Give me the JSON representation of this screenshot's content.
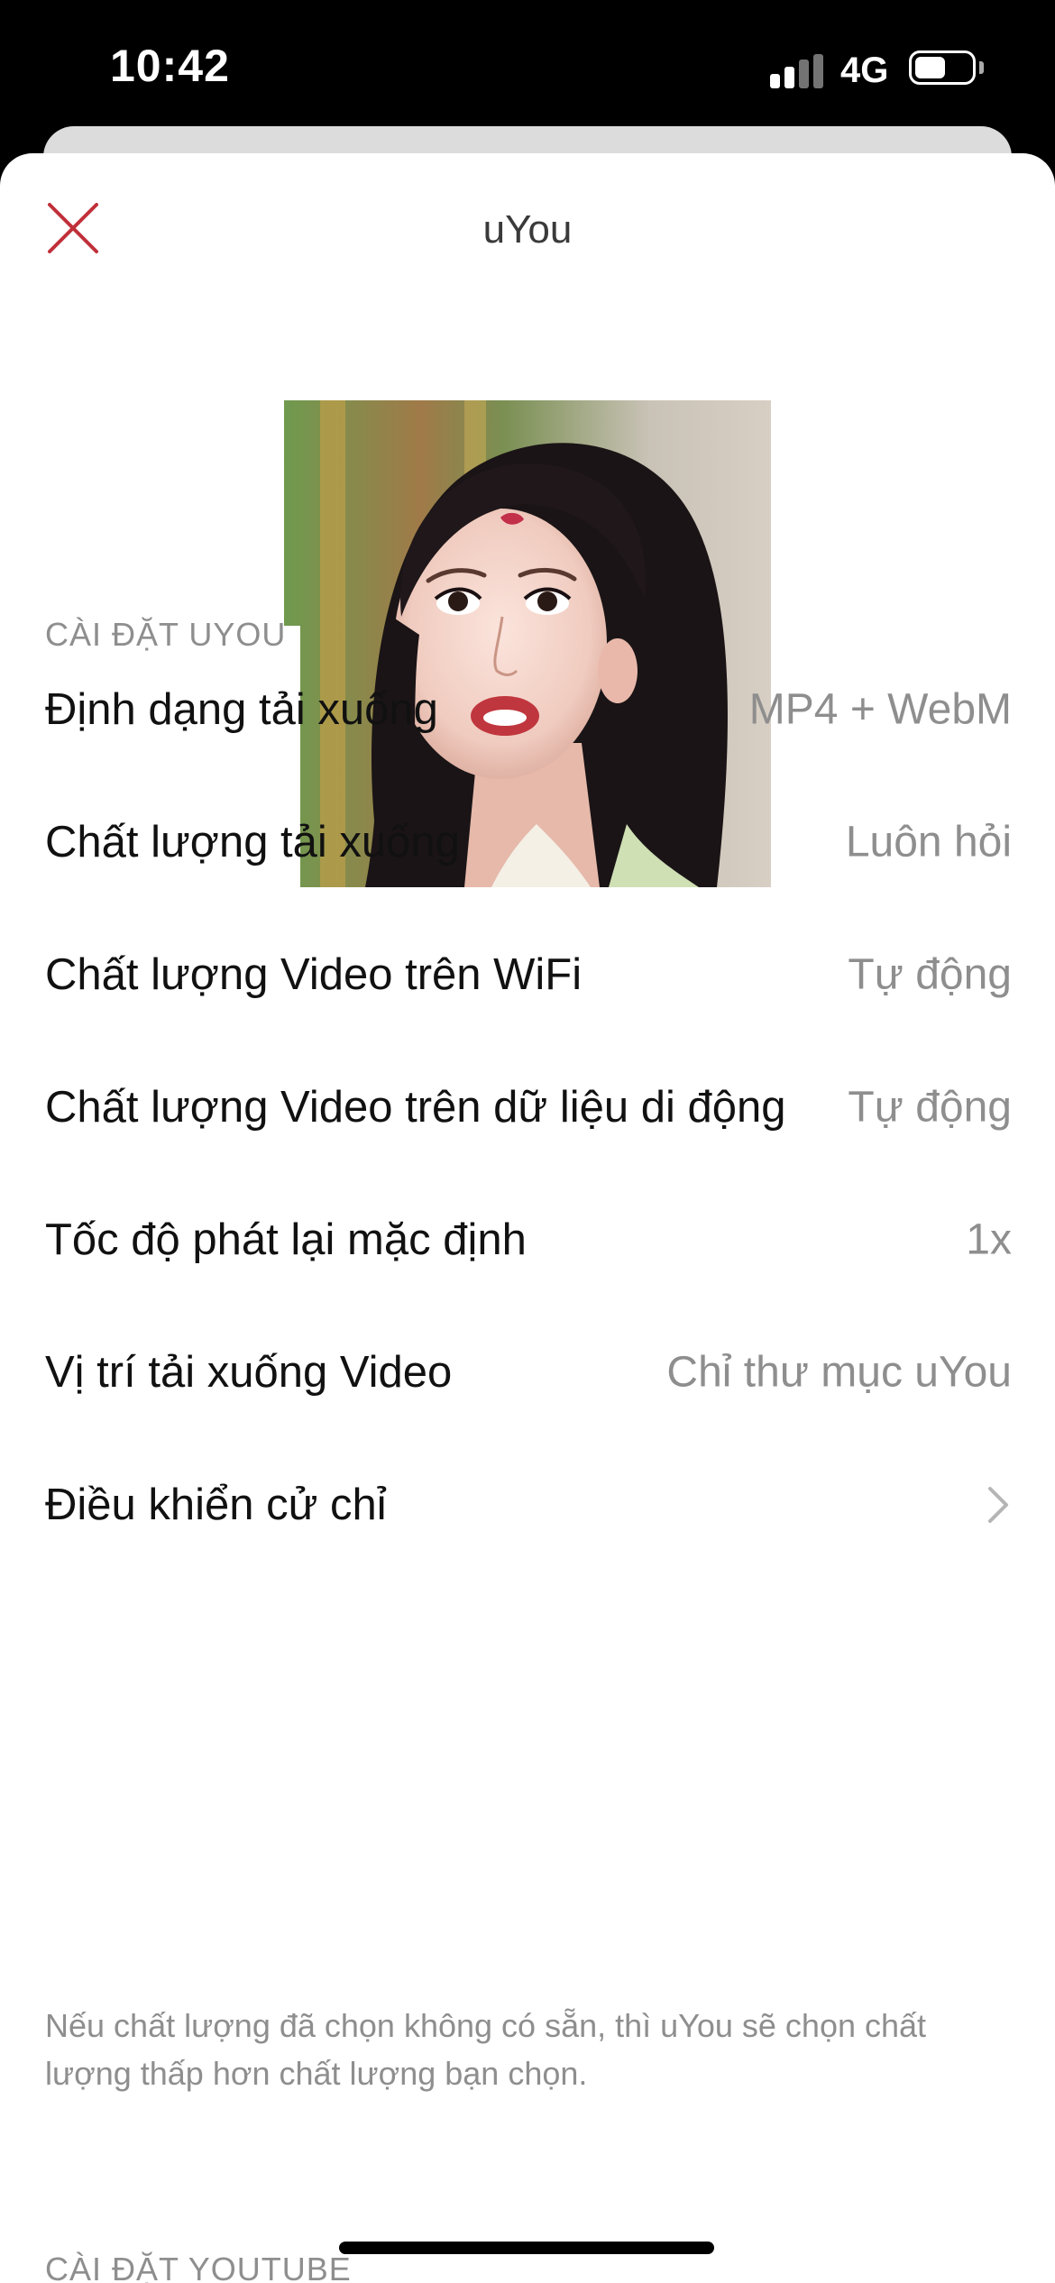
{
  "status_bar": {
    "time": "10:42",
    "network": "4G",
    "battery_level": 0.55
  },
  "header": {
    "title": "uYou",
    "close_icon": "close-x-icon",
    "accent_color": "#c0303a"
  },
  "profile": {
    "avatar_icon": "profile-avatar"
  },
  "sections": [
    {
      "header": "CÀI ĐẶT UYOU",
      "rows": [
        {
          "label": "Định dạng tải xuống",
          "value": "MP4 + WebM"
        },
        {
          "label": "Chất lượng tải xuống",
          "value": "Luôn hỏi"
        },
        {
          "label": "Chất lượng Video trên WiFi",
          "value": "Tự động"
        },
        {
          "label": "Chất lượng Video trên dữ liệu di động",
          "value": "Tự động"
        },
        {
          "label": "Tốc độ phát lại mặc định",
          "value": "1x"
        },
        {
          "label": "Vị trí tải xuống Video",
          "value": "Chỉ thư mục uYou"
        },
        {
          "label": "Điều khiển cử chỉ",
          "value": ""
        }
      ],
      "footer": "Nếu chất lượng đã chọn không có sẵn, thì uYou sẽ chọn chất lượng thấp hơn chất lượng bạn chọn."
    },
    {
      "header": "CÀI ĐẶT YOUTUBE"
    }
  ]
}
